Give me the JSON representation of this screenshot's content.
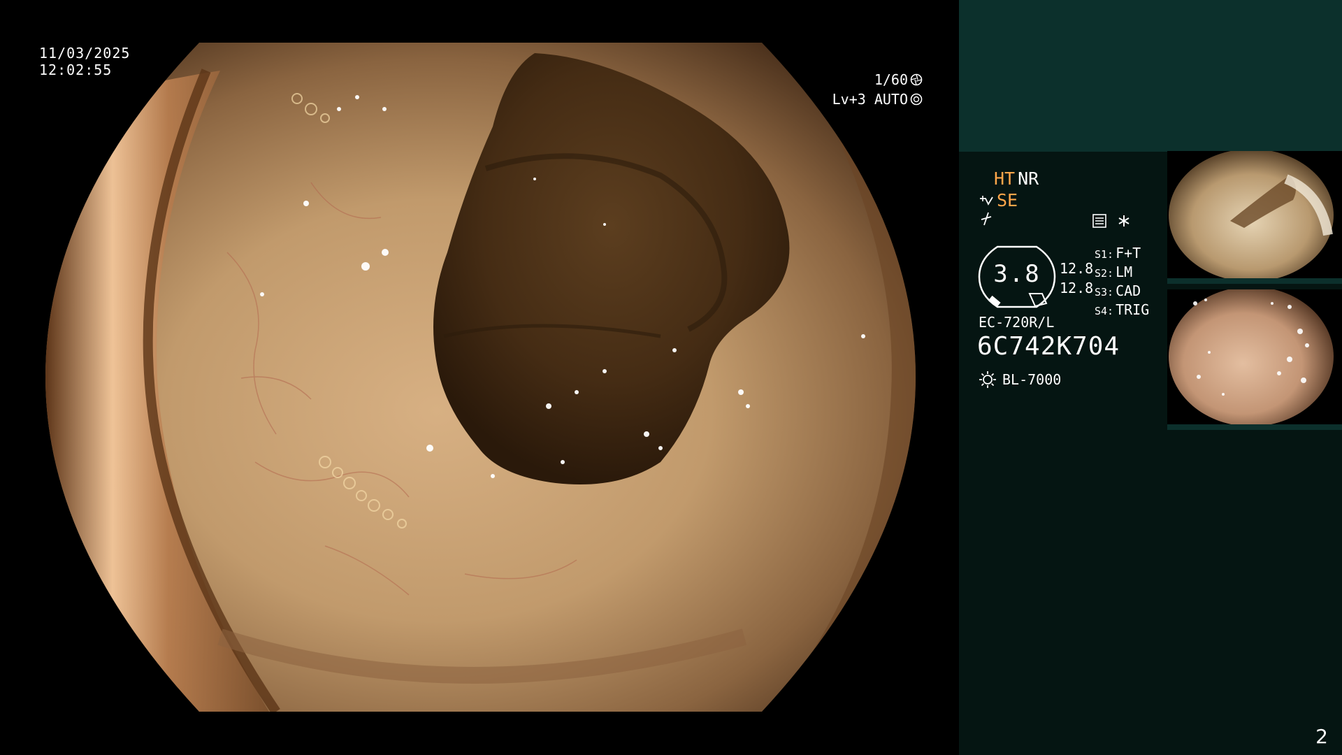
{
  "overlay": {
    "date": "11/03/2025",
    "time": "12:02:55",
    "shutter_speed": "1/60",
    "exposure": "Lv+3 AUTO"
  },
  "panel": {
    "mode_ht": "HT",
    "mode_nr": "NR",
    "mode_se": "SE",
    "zoom_value": "3.8",
    "zoom_value_a": "12.8",
    "zoom_value_b": "12.8",
    "s_items": [
      {
        "key": "S1:",
        "value": "F+T"
      },
      {
        "key": "S2:",
        "value": "LM"
      },
      {
        "key": "S3:",
        "value": "CAD"
      },
      {
        "key": "S4:",
        "value": "TRIG"
      }
    ],
    "scope_model": "EC-720R/L",
    "scope_serial": "6C742K704",
    "light_source": "BL-7000",
    "page_number": "2"
  },
  "colors": {
    "panel_bg": "#051512",
    "panel_top": "#0c302c",
    "accent_orange": "#ffa64a",
    "text": "#ffffff"
  },
  "icons": [
    "shutter-icon",
    "iris-icon",
    "structure-enhance-icon",
    "color-enhance-icon",
    "memory-icon",
    "star-icon",
    "light-source-icon"
  ]
}
